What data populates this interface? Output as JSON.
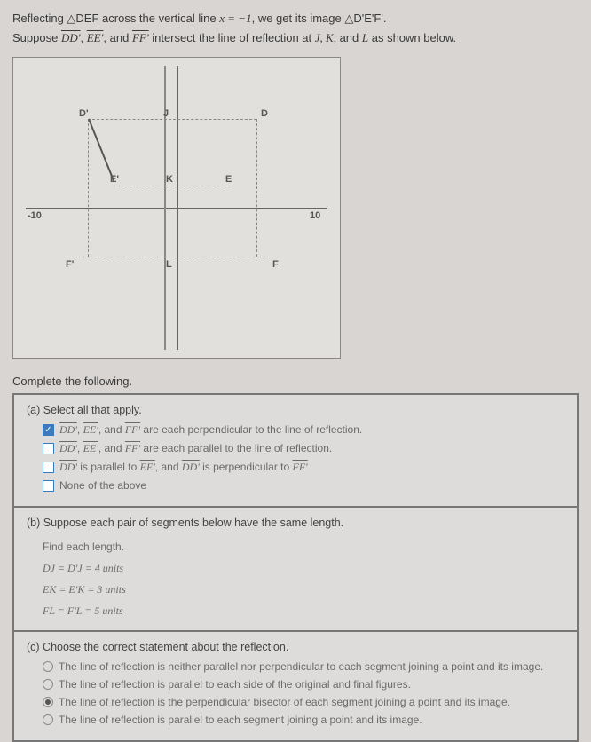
{
  "intro": {
    "line1_pre": "Reflecting ",
    "line1_tri": "△DEF",
    "line1_mid": " across the vertical line ",
    "line1_eq": "x = −1",
    "line1_post": ", we get its image ",
    "line1_tri2": "△D'E'F'.",
    "line2_pre": "Suppose ",
    "seg1": "DD'",
    "seg2": "EE'",
    "seg3": "FF'",
    "line2_mid": " intersect the line of reflection at ",
    "pts": "J, K,",
    "line2_and": " and ",
    "ptL": "L",
    "line2_post": " as shown below."
  },
  "graph": {
    "D": "D",
    "Dp": "D'",
    "E": "E",
    "Ep": "E'",
    "F": "F",
    "Fp": "F'",
    "J": "J",
    "K": "K",
    "L": "L",
    "tick_n10": "-10",
    "tick_10": "10"
  },
  "complete": "Complete the following.",
  "partA": {
    "head": "(a) Select all that apply.",
    "opt1_a": "DD'",
    "opt1_b": "EE'",
    "opt1_c": "FF'",
    "opt1_txt": " are each perpendicular to the line of reflection.",
    "opt2_txt": " are each parallel to the line of reflection.",
    "opt3_a": "DD'",
    "opt3_mid1": " is parallel to ",
    "opt3_b": "EE'",
    "opt3_mid2": ", and ",
    "opt3_c": "DD'",
    "opt3_mid3": " is perpendicular to ",
    "opt3_d": "FF'",
    "opt4": "None of the above"
  },
  "partB": {
    "head": "(b) Suppose each pair of segments below have the same length.",
    "sub": "Find each length.",
    "l1": "DJ = D'J = 4 units",
    "l2": "EK = E'K = 3 units",
    "l3": "FL = F'L = 5 units"
  },
  "partC": {
    "head": "(c) Choose the correct statement about the reflection.",
    "o1": "The line of reflection is neither parallel nor perpendicular to each segment joining a point and its image.",
    "o2": "The line of reflection is parallel to each side of the original and final figures.",
    "o3": "The line of reflection is the perpendicular bisector of each segment joining a point and its image.",
    "o4": "The line of reflection is parallel to each segment joining a point and its image."
  }
}
